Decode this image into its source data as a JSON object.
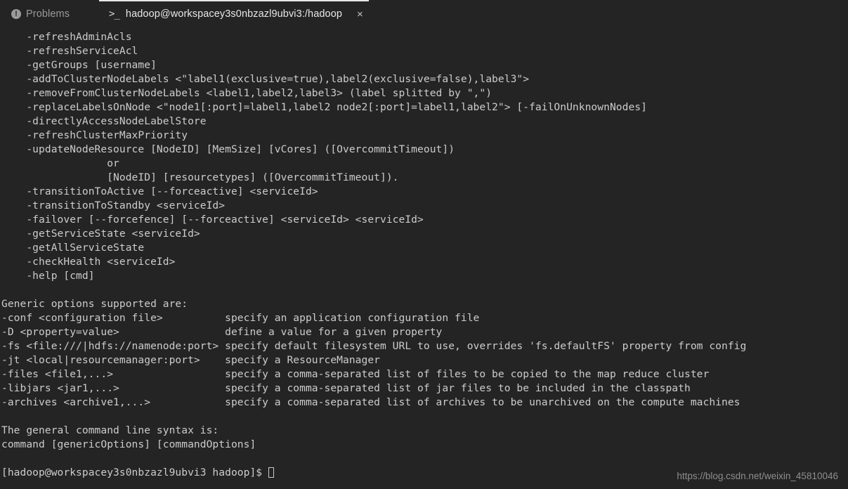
{
  "tabs": [
    {
      "id": "problems",
      "label": "Problems",
      "icon": "error-circle-icon",
      "icon_glyph": "!",
      "active": false
    },
    {
      "id": "terminal",
      "label": "hadoop@workspacey3s0nbzazl9ubvi3:/hadoop",
      "icon": "terminal-prompt-icon",
      "icon_glyph": ">_",
      "active": true,
      "close_glyph": "×"
    }
  ],
  "terminal": {
    "accent_color": "#e7e7e7",
    "background_color": "#242424",
    "text_color": "#cccccc",
    "lines": [
      "    -refreshAdminAcls",
      "    -refreshServiceAcl",
      "    -getGroups [username]",
      "    -addToClusterNodeLabels <\"label1(exclusive=true),label2(exclusive=false),label3\">",
      "    -removeFromClusterNodeLabels <label1,label2,label3> (label splitted by \",\")",
      "    -replaceLabelsOnNode <\"node1[:port]=label1,label2 node2[:port]=label1,label2\"> [-failOnUnknownNodes]",
      "    -directlyAccessNodeLabelStore",
      "    -refreshClusterMaxPriority",
      "    -updateNodeResource [NodeID] [MemSize] [vCores] ([OvercommitTimeout])",
      "                 or",
      "                 [NodeID] [resourcetypes] ([OvercommitTimeout]).",
      "    -transitionToActive [--forceactive] <serviceId>",
      "    -transitionToStandby <serviceId>",
      "    -failover [--forcefence] [--forceactive] <serviceId> <serviceId>",
      "    -getServiceState <serviceId>",
      "    -getAllServiceState",
      "    -checkHealth <serviceId>",
      "    -help [cmd]",
      "",
      "Generic options supported are:",
      "-conf <configuration file>          specify an application configuration file",
      "-D <property=value>                 define a value for a given property",
      "-fs <file:///|hdfs://namenode:port> specify default filesystem URL to use, overrides 'fs.defaultFS' property from config",
      "-jt <local|resourcemanager:port>    specify a ResourceManager",
      "-files <file1,...>                  specify a comma-separated list of files to be copied to the map reduce cluster",
      "-libjars <jar1,...>                 specify a comma-separated list of jar files to be included in the classpath",
      "-archives <archive1,...>            specify a comma-separated list of archives to be unarchived on the compute machines",
      "",
      "The general command line syntax is:",
      "command [genericOptions] [commandOptions]",
      ""
    ],
    "prompt": "[hadoop@workspacey3s0nbzazl9ubvi3 hadoop]$ "
  },
  "watermark": {
    "text": "https://blog.csdn.net/weixin_45810046"
  }
}
